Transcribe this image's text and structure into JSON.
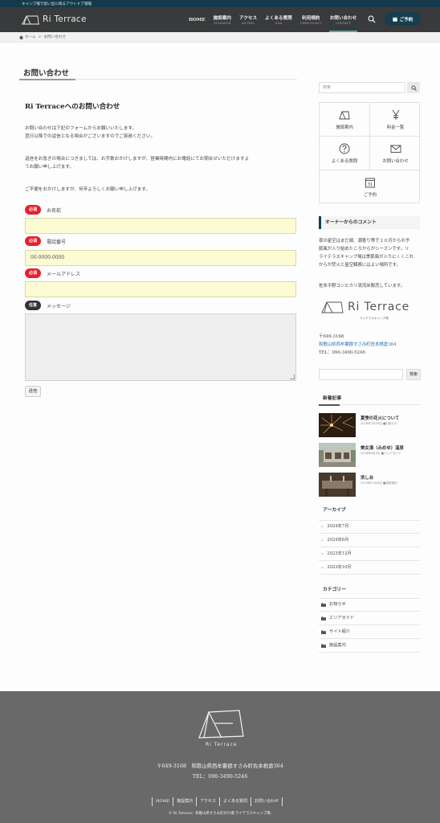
{
  "topbar": {
    "tagline": "キャンプ場で思い出に残るアウトドア冒険"
  },
  "header": {
    "logo_text": "Ri Terrace",
    "nav": [
      {
        "label": "HOME",
        "sub": ""
      },
      {
        "label": "施設案内",
        "sub": "GUIDANCE"
      },
      {
        "label": "アクセス",
        "sub": "ACCESS"
      },
      {
        "label": "よくある質問",
        "sub": "Q&A"
      },
      {
        "label": "利用規約",
        "sub": "USER POLICY"
      },
      {
        "label": "お問い合わせ",
        "sub": "CONTACT"
      }
    ],
    "reserve_label": "ご予約",
    "search_icon": "search-icon",
    "accent_color": "#53a6a0",
    "header_bg": "#393a3b"
  },
  "breadcrumb": {
    "home": "ホーム",
    "separator": ">",
    "current": "お問い合わせ"
  },
  "page": {
    "title": "お問い合わせ",
    "heading": "Ri Terraceへのお問い合わせ",
    "para1_line1": "お問い合わせは下記のフォームからお願いいたします。",
    "para1_line2": "翌日以降での返信となる場合がございますのでご容赦ください。",
    "para2_line1": "返信をお急ぎの場合につきましては、お手数おかけしますが、営業時間内にお電話にてお問合せいただけますよ",
    "para2_line2": "うお願い申し上げます。",
    "para3": "ご不便をおかけしますが、何卒よろしくお願い申し上げます。"
  },
  "form": {
    "required_badge": "必須",
    "optional_badge": "任意",
    "name_label": "お名前",
    "name_value": "",
    "phone_label": "電話番号",
    "phone_placeholder": "00-0000-0000",
    "email_label": "メールアドレス",
    "email_value": "",
    "message_label": "メッセージ",
    "submit_label": "送信",
    "required_color": "#e8202e"
  },
  "sidebar": {
    "search_placeholder": "検索",
    "grid": [
      {
        "label": "施設案内",
        "icon": "tent-icon"
      },
      {
        "label": "料金一覧",
        "icon": "yen-icon"
      },
      {
        "label": "よくある質問",
        "icon": "question-icon"
      },
      {
        "label": "お問い合わせ",
        "icon": "mail-icon"
      },
      {
        "label": "ご予約",
        "icon": "calendar-icon"
      }
    ],
    "calendar_day": "31",
    "owner_heading": "オーナーからのコメント",
    "owner_line1": "夜の星空はまだ綺、潮香り等で１０月からの予",
    "owner_line2": "節風が入り始めたころからがシーズンです。リ",
    "owner_line3": "ライテラスキャンプ場は季節風が入りにくくこれ",
    "owner_line4": "からが焚火と星空観察にはよい場所です。",
    "owner_line5": "佐本平野コシヒカリ清流米販売しています。",
    "logo_text": "Ri Terrace",
    "logo_sub": "ライテラスキャンプ場",
    "postal": "〒649-3168",
    "address": "和歌山県西牟婁郡すさみ町佐本根倉364",
    "tel": "TEL：090-3490-5246",
    "search_button": "検索",
    "news_heading": "新着記事",
    "posts": [
      {
        "title": "夏季の花火について",
        "date": "2024年7月18日",
        "category": "お知らせ"
      },
      {
        "title": "美女湯（みめゆ）温泉",
        "date": "2024年6月3日",
        "category": "エリアガイド"
      },
      {
        "title": "洗し台",
        "date": "2023年12月4日",
        "category": "施設案内"
      }
    ],
    "archive_heading": "アーカイブ",
    "archives": [
      "2024年7月",
      "2024年6月",
      "2023年12月",
      "2023年10月"
    ],
    "category_heading": "カテゴリー",
    "categories": [
      "お知らせ",
      "エリアガイド",
      "サイト紹介",
      "施設案内"
    ]
  },
  "footer": {
    "logo_text": "Ri Terrace",
    "address": "〒649-3168　和歌山県西牟婁郡すさみ町佐本根倉364",
    "tel": "TEL：090-3490-5246",
    "nav": [
      "HOME",
      "施設案内",
      "アクセス",
      "よくある質問",
      "お問い合わせ"
    ],
    "copyright": "© Ri Terrace：和歌山県すさみ町の穴場 ライテラスキャンプ場."
  }
}
